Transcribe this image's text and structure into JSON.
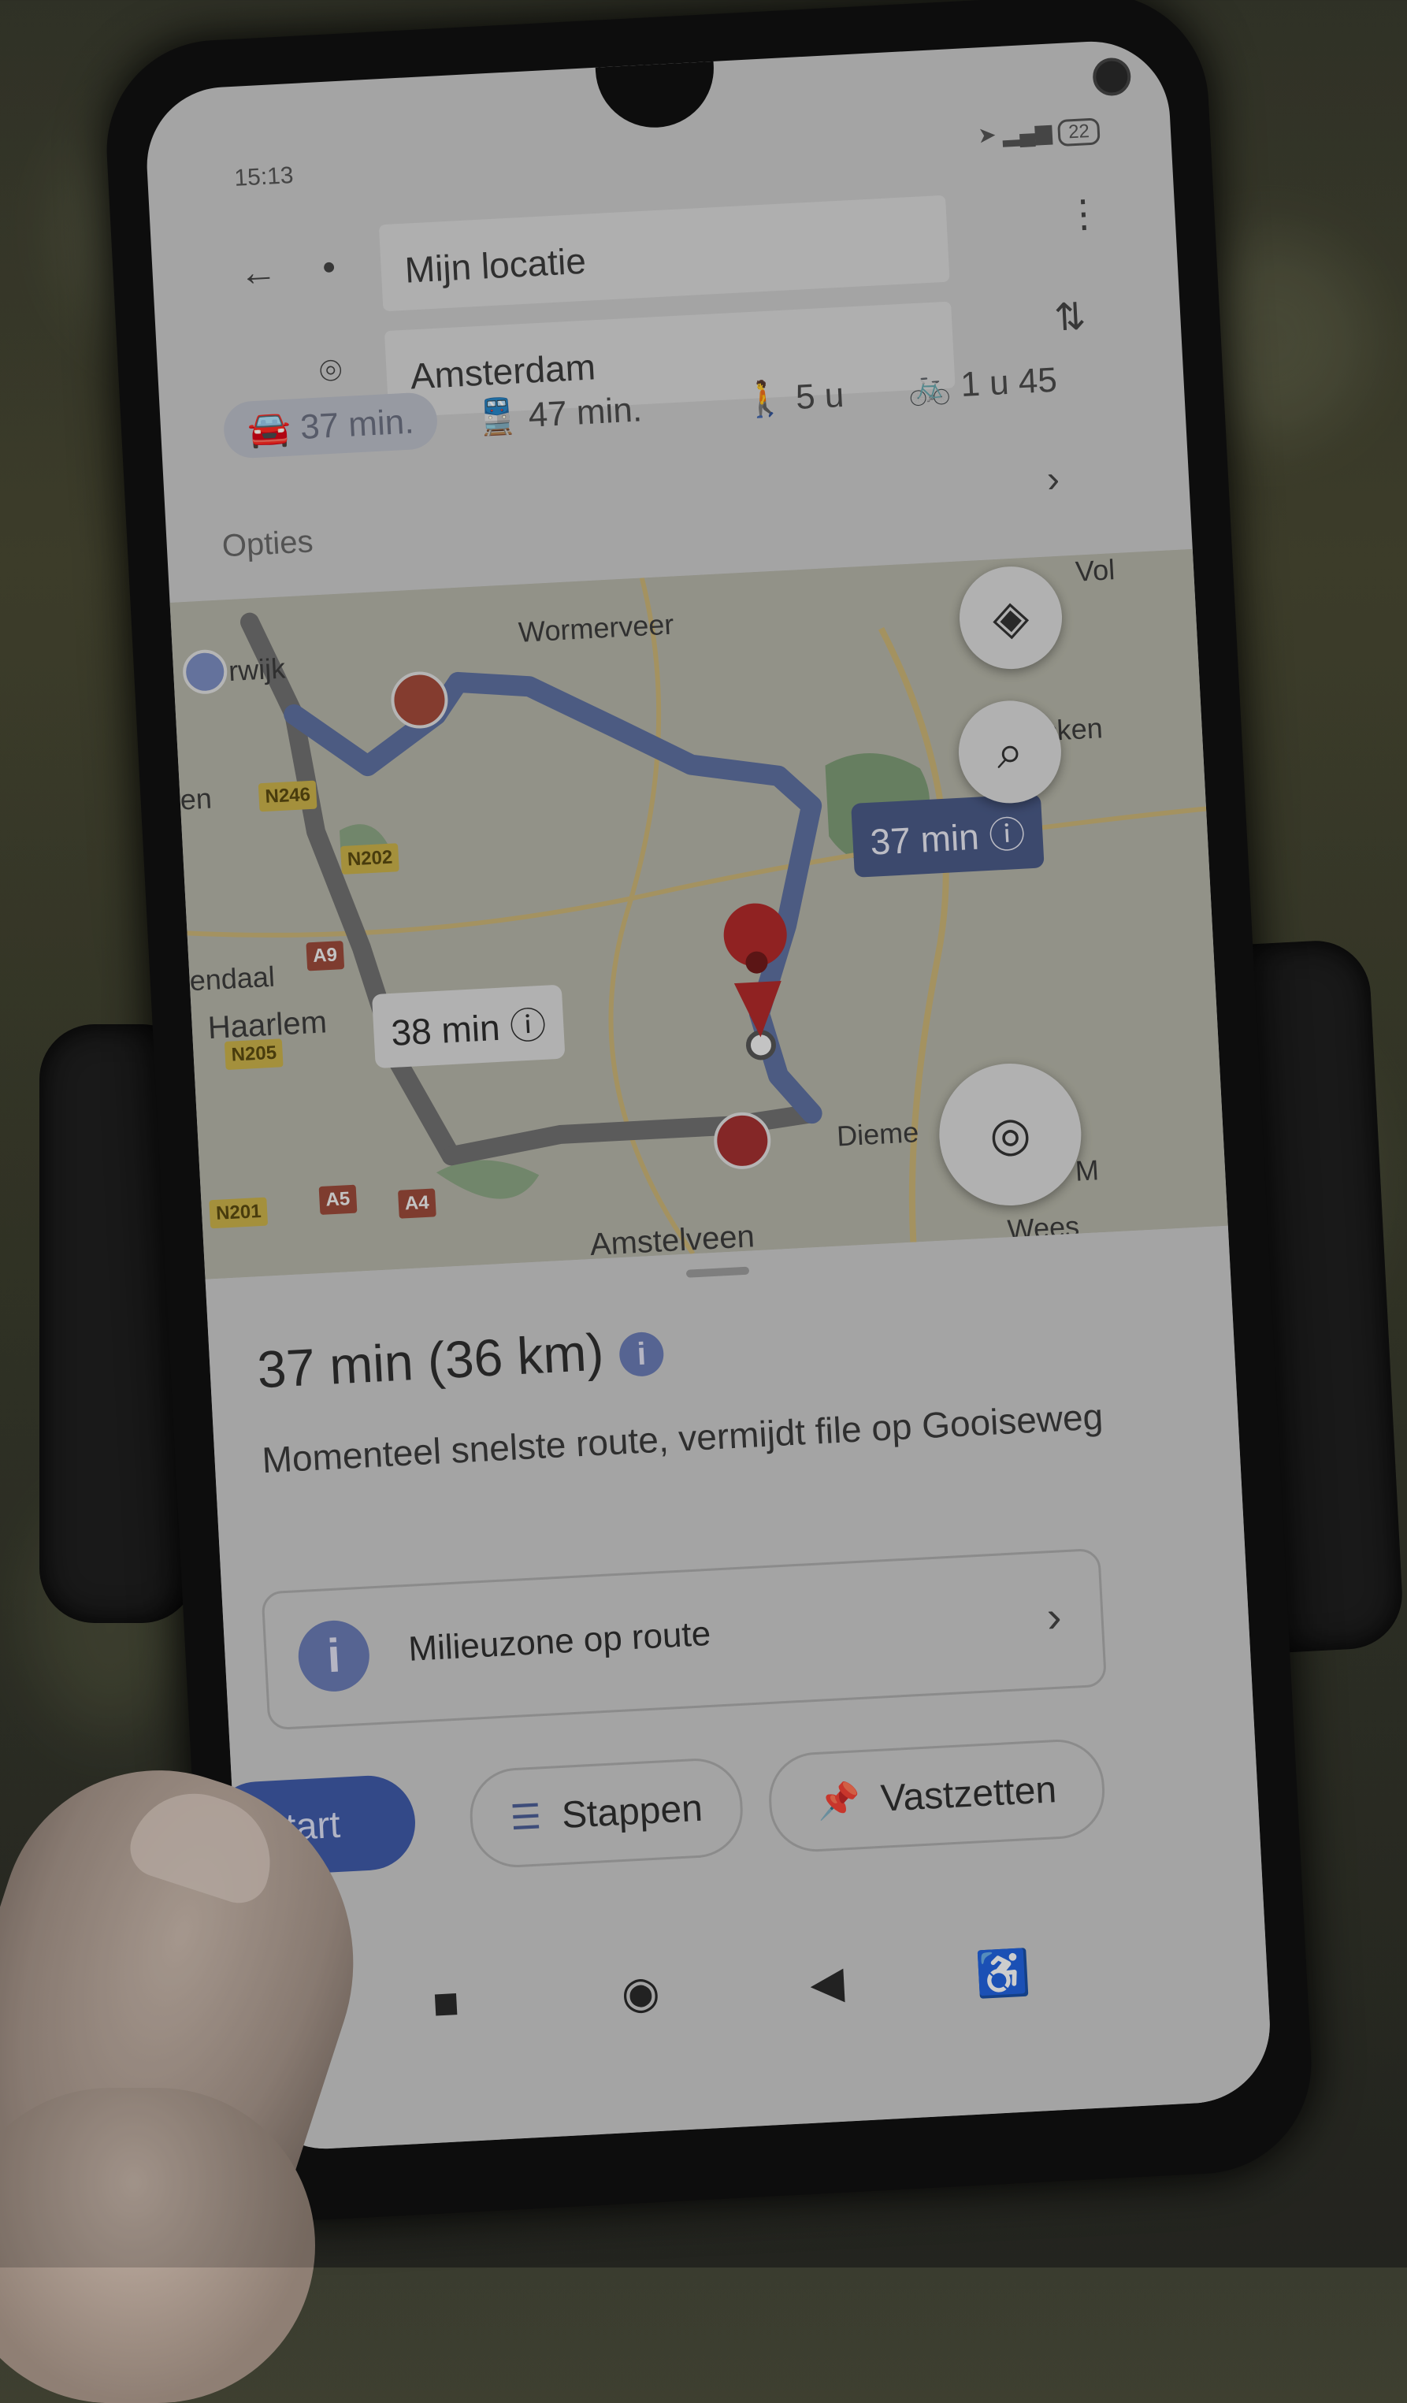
{
  "status": {
    "time": "15:13",
    "battery": "22"
  },
  "search": {
    "origin": "Mijn locatie",
    "destination": "Amsterdam"
  },
  "modes": [
    {
      "icon": "car-icon",
      "label": "37 min."
    },
    {
      "icon": "transit-icon",
      "label": "47 min."
    },
    {
      "icon": "walk-icon",
      "label": "5 u"
    },
    {
      "icon": "bike-icon",
      "label": "1 u 45"
    }
  ],
  "options_label": "Opties",
  "map": {
    "places": [
      "Wormerveer",
      "Monnicken",
      "Haarlem",
      "Amstelveen",
      "Dieme",
      "rwijk",
      "Vol",
      "endaal",
      "Wees",
      "M",
      "en"
    ],
    "roads": [
      "N246",
      "N202",
      "A9",
      "N205",
      "N201",
      "A5",
      "A4"
    ],
    "route_bubbles": [
      "37 min",
      "38 min"
    ]
  },
  "route": {
    "summary": "37 min (36 km)",
    "description": "Momenteel snelste route, vermijdt file op Gooiseweg",
    "notice": "Milieuzone op route"
  },
  "buttons": {
    "start": "tart",
    "steps": "Stappen",
    "pin": "Vastzetten"
  },
  "colors": {
    "accent": "#3f5aa6",
    "route_blue": "#5d6f9f",
    "route_gray": "#6f6f6f",
    "marker_red": "#b02a2a"
  }
}
